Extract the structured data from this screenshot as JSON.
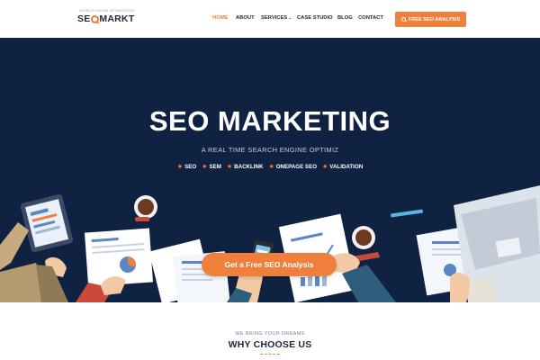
{
  "header": {
    "logo_tagline": "SEARCH ENGINE OPTIMIZATION",
    "logo_text_before": "SE",
    "logo_text_after": "MARKT",
    "nav": [
      {
        "label": "HOME",
        "active": true
      },
      {
        "label": "ABOUT",
        "active": false
      },
      {
        "label": "SERVICES",
        "active": false,
        "has_dropdown": true
      },
      {
        "label": "CASE STUDIO",
        "active": false
      },
      {
        "label": "BLOG",
        "active": false
      },
      {
        "label": "CONTACT",
        "active": false
      }
    ],
    "cta_label": "FREE SEO ANALYSIS",
    "cta_icon": "search-icon"
  },
  "hero": {
    "title": "SEO MARKETING",
    "subtitle": "A REAL TIME SEARCH ENGINE OPTIMIZ",
    "tags": [
      "SEO",
      "SEM",
      "BACKLINK",
      "ONEPAGE SEO",
      "VALIDATION"
    ],
    "cta_label": "Get a Free SEO Analysis"
  },
  "why": {
    "pretitle": "WE BRING YOUR DREAMS",
    "title": "WHY CHOOSE US"
  },
  "colors": {
    "accent": "#f07f3c",
    "hero_bg": "#0f2242",
    "dark_text": "#1d2738"
  }
}
